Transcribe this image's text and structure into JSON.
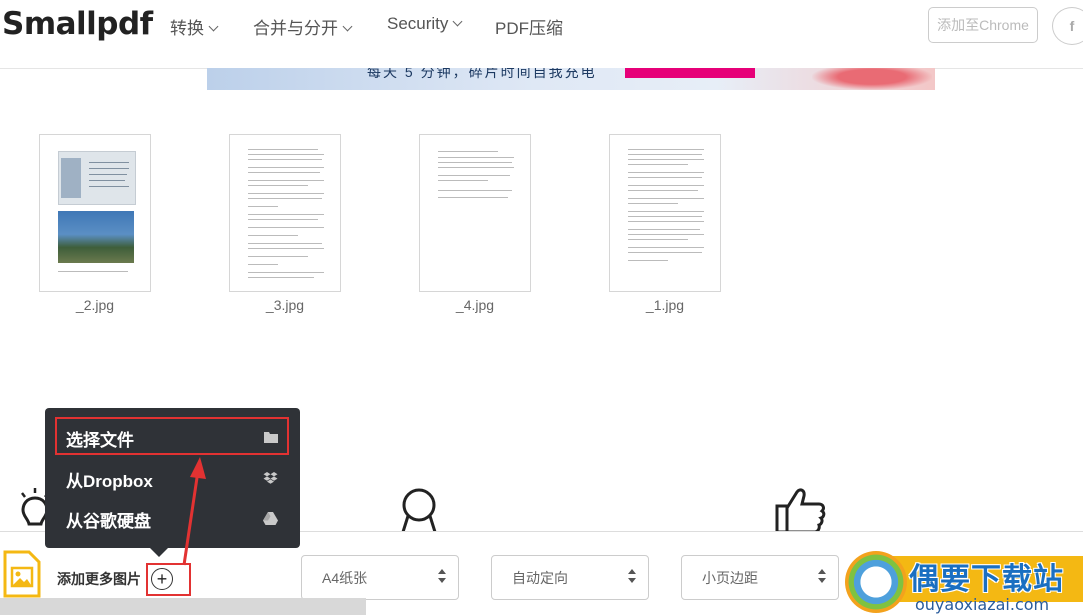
{
  "header": {
    "logo": "Smallpdf",
    "nav": [
      {
        "label": "转换"
      },
      {
        "label": "合并与分开"
      },
      {
        "label": "Security"
      },
      {
        "label": "PDF压缩"
      }
    ],
    "chrome_button": "添加至Chrome",
    "facebook_button": "f"
  },
  "banner": {
    "text": "每天 5 分钟，碎片时间自我充电"
  },
  "pages": [
    {
      "label": "_2.jpg"
    },
    {
      "label": "_3.jpg"
    },
    {
      "label": "_4.jpg"
    },
    {
      "label": "_1.jpg"
    }
  ],
  "dropdown": {
    "items": [
      {
        "label": "选择文件",
        "icon": "folder-icon"
      },
      {
        "label": "从Dropbox",
        "icon": "dropbox-icon"
      },
      {
        "label": "从谷歌硬盘",
        "icon": "google-drive-icon"
      }
    ]
  },
  "toolbar": {
    "add_more_label": "添加更多图片",
    "page_size": "A4纸张",
    "orientation": "自动定向",
    "margin": "小页边距"
  },
  "watermark": {
    "title": "偶要下载站",
    "url": "ouyaoxiazai.com"
  },
  "colors": {
    "accent": "#f4b813",
    "highlight": "#e23232",
    "dropdown_bg": "#2f3237"
  }
}
